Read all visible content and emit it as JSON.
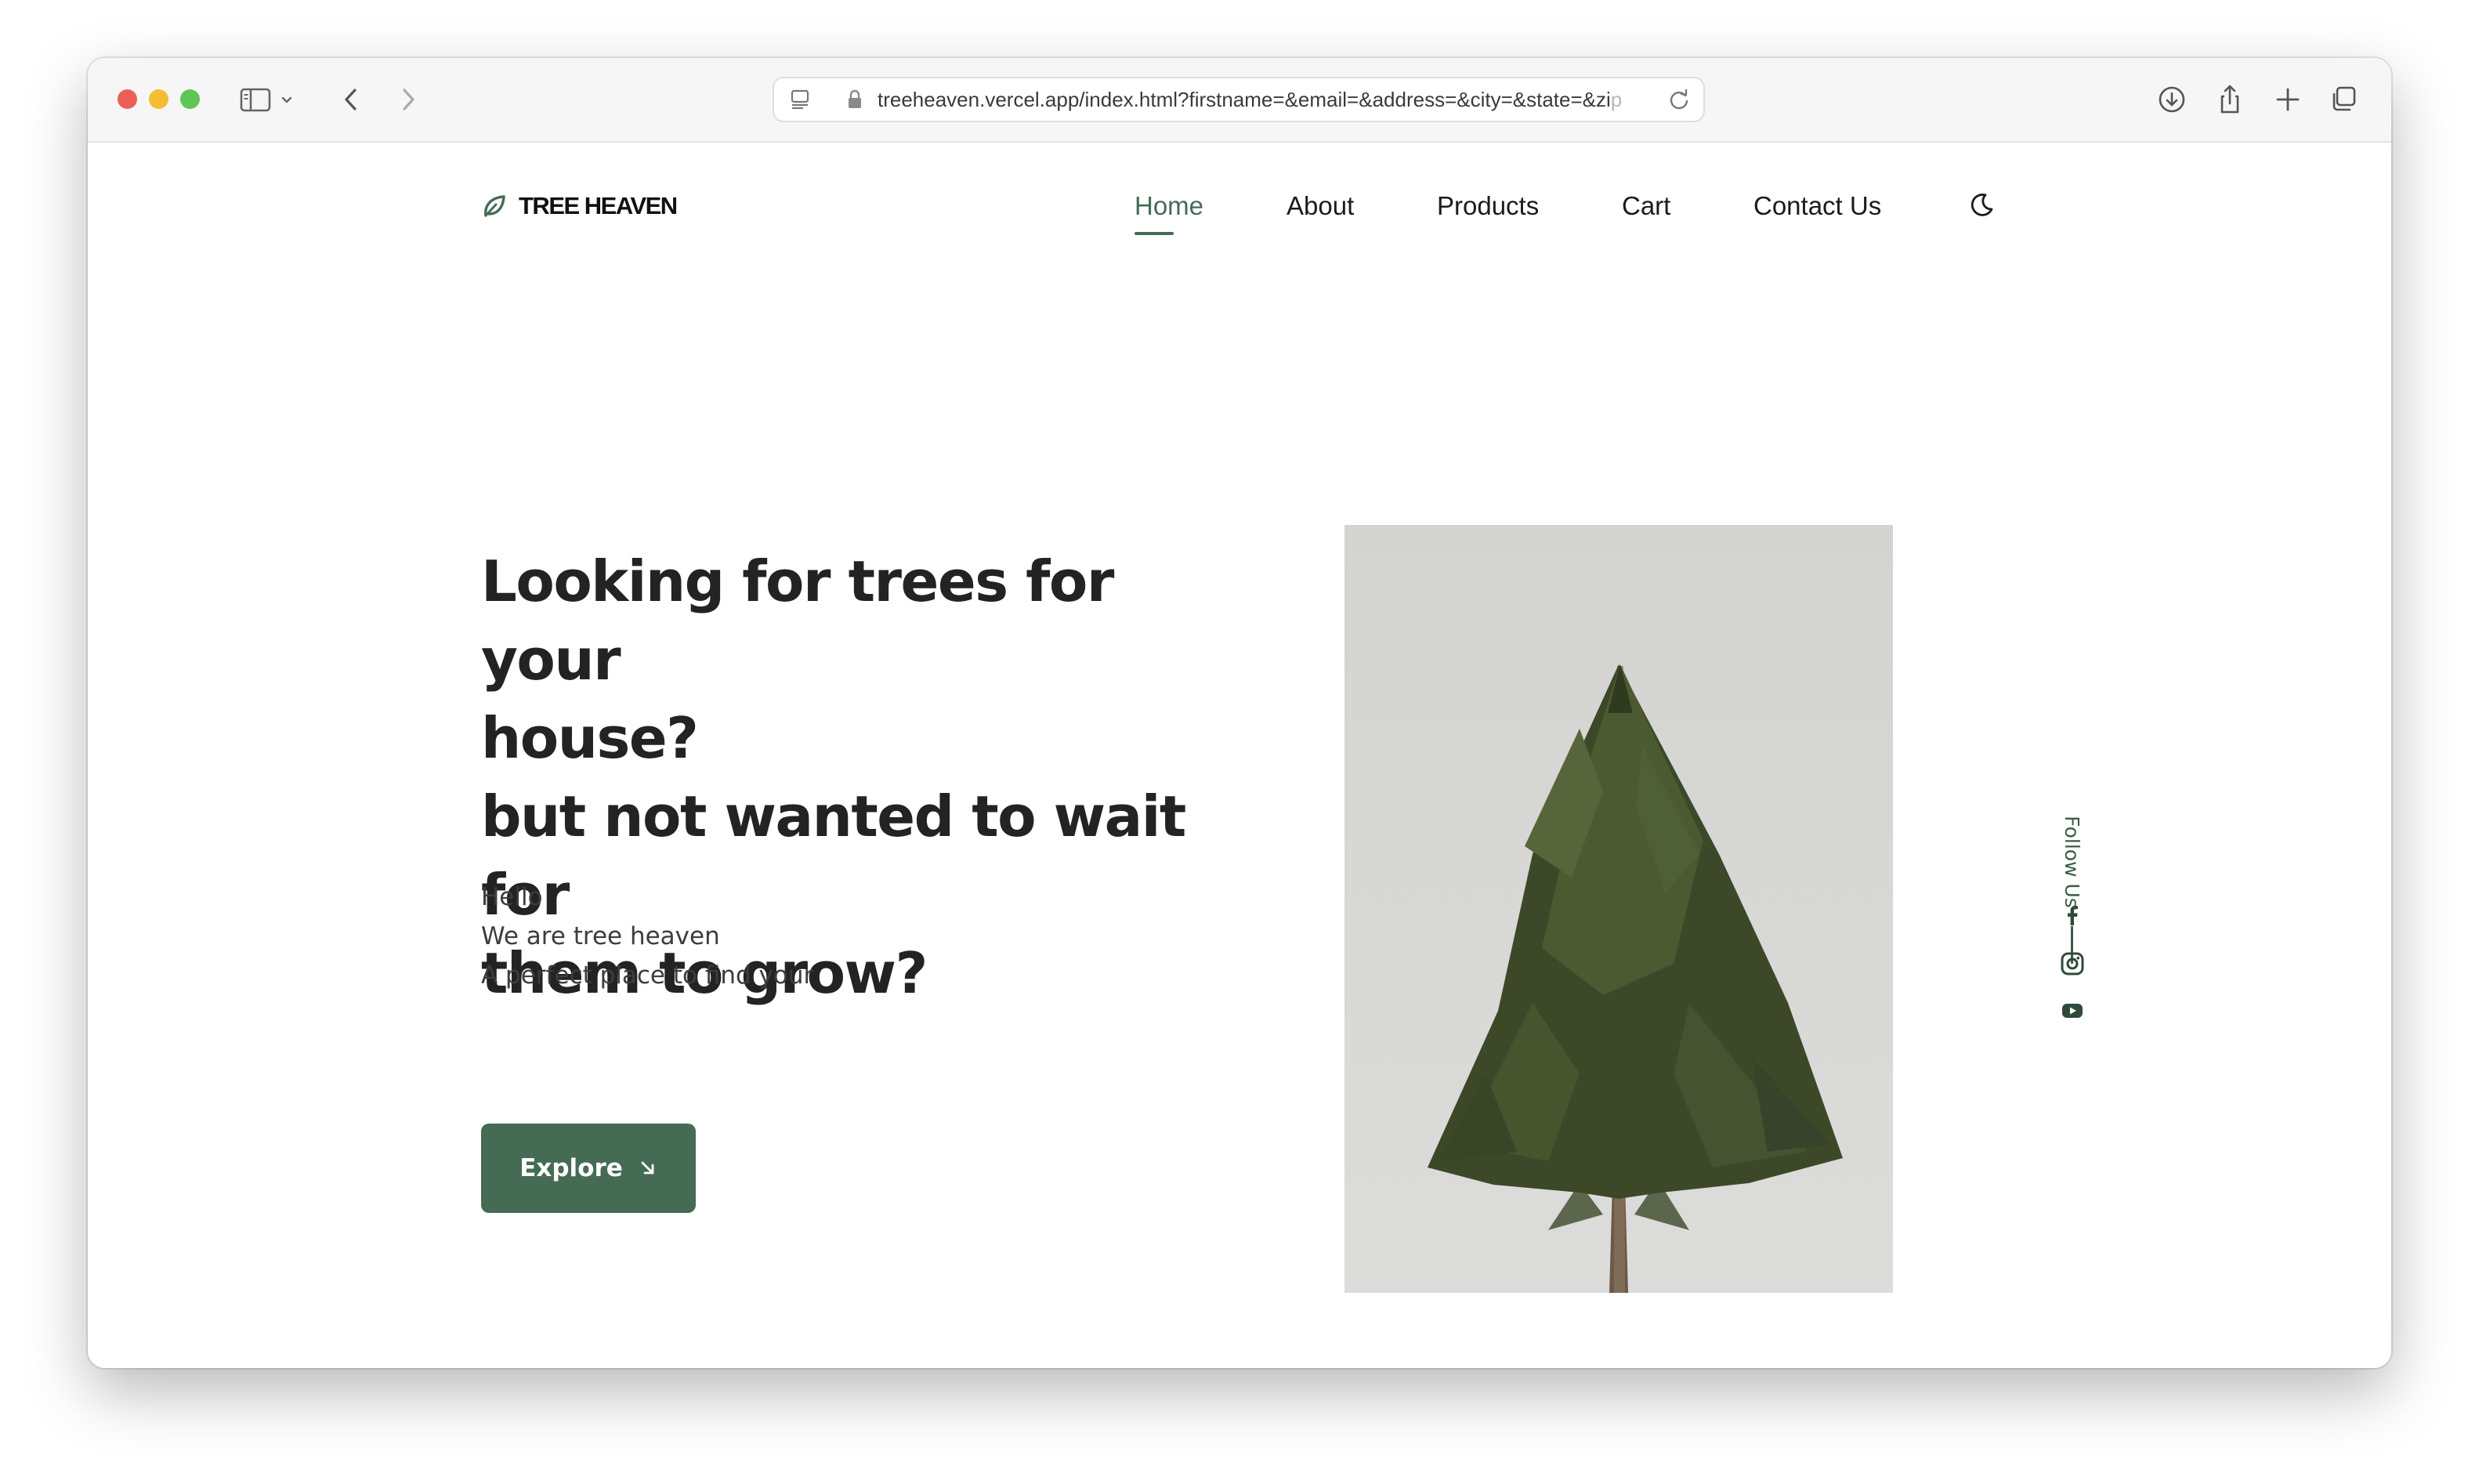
{
  "browser": {
    "url": "treeheaven.vercel.app/index.html?firstname=&email=&address=&city=&state=&zi",
    "url_fade": "p"
  },
  "brand": {
    "name": "TREE HEAVEN",
    "logo_icon": "leaf-icon",
    "accent_color": "#456b55"
  },
  "nav": {
    "items": [
      {
        "label": "Home",
        "active": true
      },
      {
        "label": "About"
      },
      {
        "label": "Products"
      },
      {
        "label": "Cart"
      },
      {
        "label": "Contact Us"
      }
    ],
    "theme_toggle_icon": "moon-icon"
  },
  "hero": {
    "headline_lines": [
      "Looking for trees for your",
      "house?",
      "but not wanted to wait for",
      "them to grow?"
    ],
    "intro_lines": [
      "Hello",
      "We are tree heaven",
      "A perfect place to find your"
    ],
    "cta_label": "Explore",
    "cta_icon": "arrow-down-right-icon",
    "image_icon": "pine-tree-image"
  },
  "social": {
    "label": "Follow Us",
    "icons": [
      "facebook-icon",
      "instagram-icon",
      "youtube-icon"
    ]
  }
}
